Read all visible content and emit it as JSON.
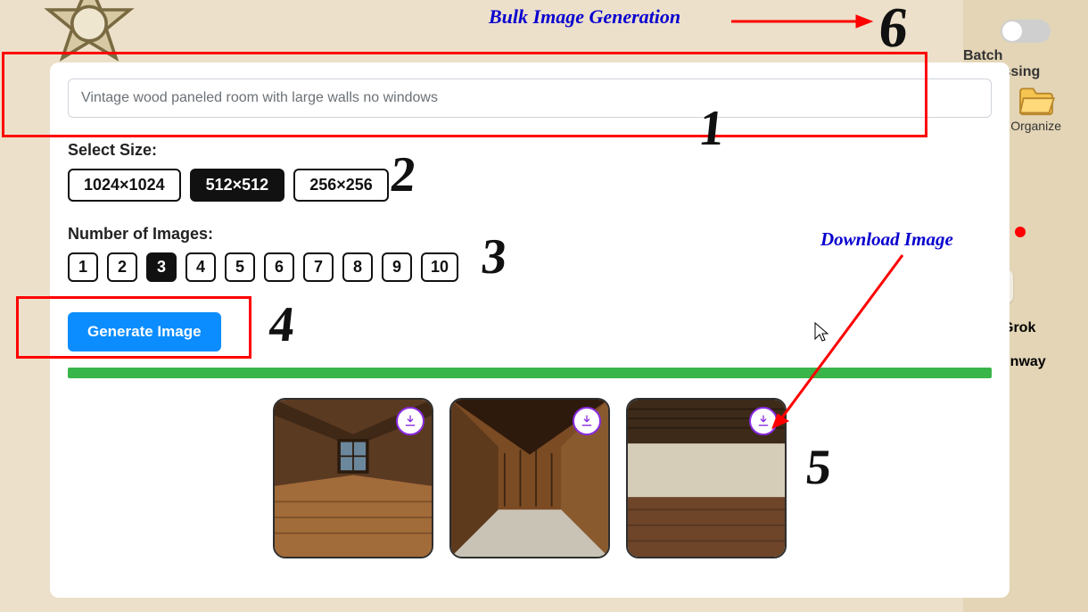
{
  "annotations": {
    "top_title": "Bulk Image Generation",
    "download_label": "Download Image",
    "numbers": {
      "n1": "1",
      "n2": "2",
      "n3": "3",
      "n4": "4",
      "n5": "5",
      "n6": "6"
    }
  },
  "side": {
    "batch_label": "Batch Processing",
    "organize_label": "Organize",
    "apps": {
      "grok": "Grok",
      "runway": "runway"
    }
  },
  "form": {
    "prompt_value": "Vintage wood paneled room with large walls no windows",
    "size_label": "Select Size:",
    "sizes": [
      "1024×1024",
      "512×512",
      "256×256"
    ],
    "size_selected_index": 1,
    "count_label": "Number of Images:",
    "counts": [
      "1",
      "2",
      "3",
      "4",
      "5",
      "6",
      "7",
      "8",
      "9",
      "10"
    ],
    "count_selected_index": 2,
    "generate_label": "Generate Image"
  },
  "gallery": {
    "images": [
      {
        "alt": "wood_room_1"
      },
      {
        "alt": "wood_room_2"
      },
      {
        "alt": "wood_room_3"
      }
    ]
  },
  "colors": {
    "accent": "#0b8dff",
    "progress": "#39b54a",
    "annotation_red": "#ff0000",
    "annotation_blue": "#0900CF"
  }
}
